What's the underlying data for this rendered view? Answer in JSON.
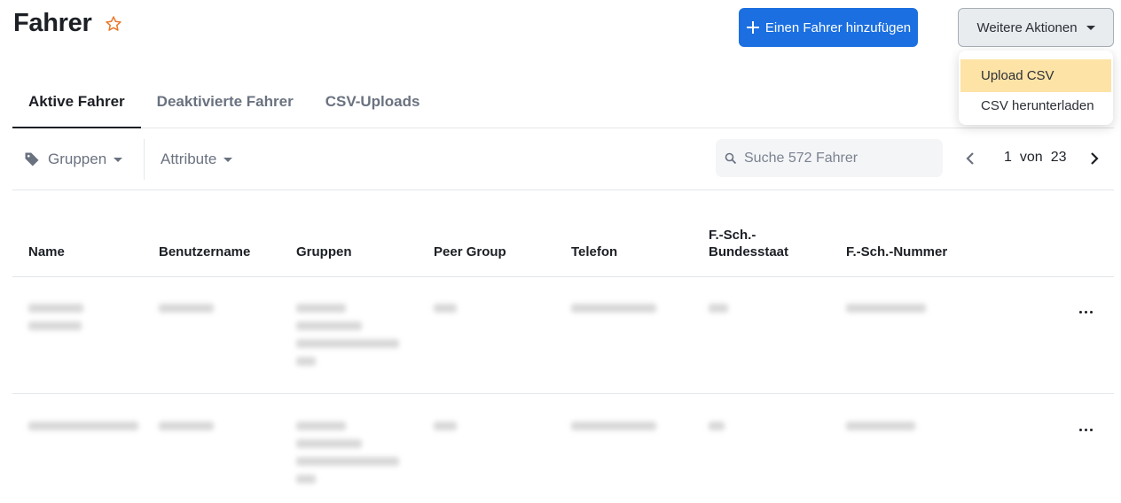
{
  "header": {
    "title": "Fahrer",
    "favorite_icon": "star-outline-icon",
    "add_button_label": "Einen Fahrer hinzufügen",
    "more_actions_label": "Weitere Aktionen"
  },
  "more_actions_menu": {
    "items": [
      {
        "label": "Upload CSV",
        "highlighted": true
      },
      {
        "label": "CSV herunterladen",
        "highlighted": false
      }
    ]
  },
  "tabs": [
    {
      "label": "Aktive Fahrer",
      "active": true
    },
    {
      "label": "Deaktivierte Fahrer",
      "active": false
    },
    {
      "label": "CSV-Uploads",
      "active": false
    }
  ],
  "filters": {
    "groups_label": "Gruppen",
    "attributes_label": "Attribute",
    "search_placeholder": "Suche 572 Fahrer",
    "search_value": ""
  },
  "pagination": {
    "current": "1",
    "separator": "von",
    "total": "23"
  },
  "table": {
    "columns": [
      "Name",
      "Benutzername",
      "Gruppen",
      "Peer Group",
      "Telefon",
      "F.-Sch.-\nBundesstaat",
      "F.-Sch.-Nummer"
    ],
    "columns_display": {
      "name": "Name",
      "username": "Benutzername",
      "groups": "Gruppen",
      "peer_group": "Peer Group",
      "phone": "Telefon",
      "license_state_1": "F.-Sch.-",
      "license_state_2": "Bundesstaat",
      "license_number": "F.-Sch.-Nummer"
    },
    "rows_note": "row contents are blurred/redacted in the screenshot",
    "row_count_visible": 2
  },
  "colors": {
    "primary": "#1b6fe0",
    "menu_highlight": "#fde3a6",
    "star": "#e8792c"
  }
}
